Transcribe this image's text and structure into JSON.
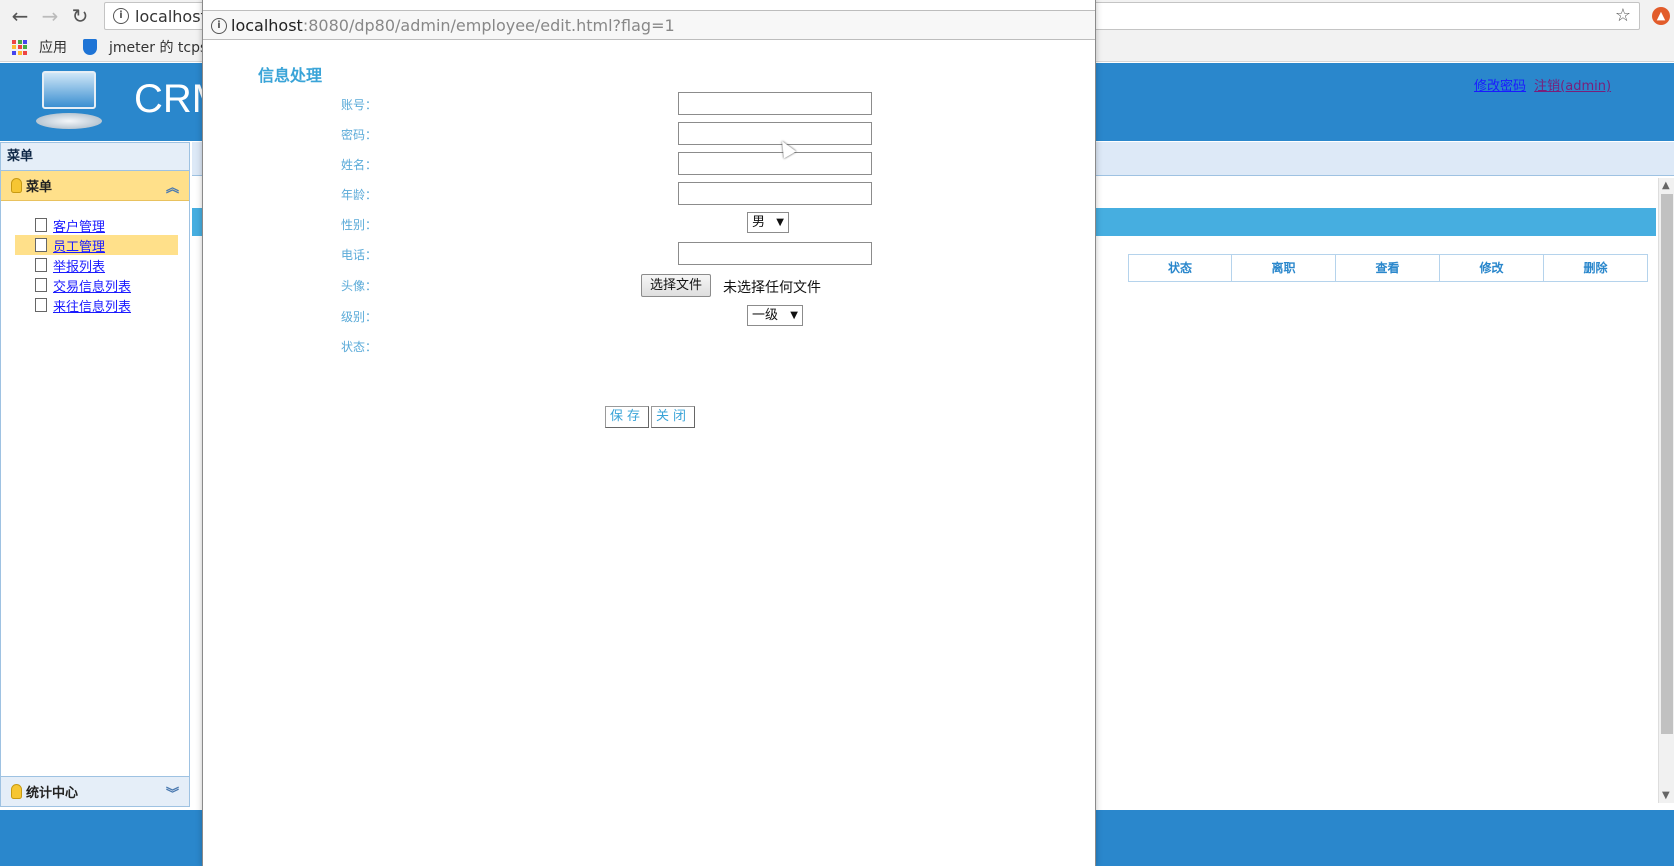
{
  "browser": {
    "url_main": "localhost",
    "bookmarks": {
      "apps": "应用",
      "jmeter": "jmeter 的 tcpsam"
    }
  },
  "app": {
    "title": "CRM",
    "header_links": {
      "change_password": "修改密码",
      "logout": "注销(admin)"
    }
  },
  "sidebar": {
    "title": "菜单",
    "panel_title": "菜单",
    "items": [
      {
        "label": "客户管理",
        "active": false
      },
      {
        "label": "员工管理",
        "active": true
      },
      {
        "label": "举报列表",
        "active": false
      },
      {
        "label": "交易信息列表",
        "active": false
      },
      {
        "label": "来往信息列表",
        "active": false
      }
    ],
    "bottom_panel": "统计中心"
  },
  "table": {
    "headers": [
      "状态",
      "离职",
      "查看",
      "修改",
      "删除"
    ]
  },
  "popup": {
    "url_host": "localhost",
    "url_rest": ":8080/dp80/admin/employee/edit.html?flag=1",
    "form_title": "信息处理",
    "fields": {
      "account": {
        "label": "账号：",
        "value": ""
      },
      "password": {
        "label": "密码：",
        "value": ""
      },
      "name": {
        "label": "姓名：",
        "value": ""
      },
      "age": {
        "label": "年龄：",
        "value": ""
      },
      "gender": {
        "label": "性别：",
        "selected": "男"
      },
      "phone": {
        "label": "电话：",
        "value": ""
      },
      "avatar": {
        "label": "头像：",
        "button": "选择文件",
        "status": "未选择任何文件"
      },
      "level": {
        "label": "级别：",
        "selected": "一级"
      },
      "state": {
        "label": "状态："
      }
    },
    "buttons": {
      "save": "保存",
      "close": "关闭"
    }
  },
  "colors": {
    "header_blue": "#2a87cc",
    "label_blue": "#5aaad8",
    "menu_active": "#ffe08a",
    "table_bar": "#46aee0"
  }
}
